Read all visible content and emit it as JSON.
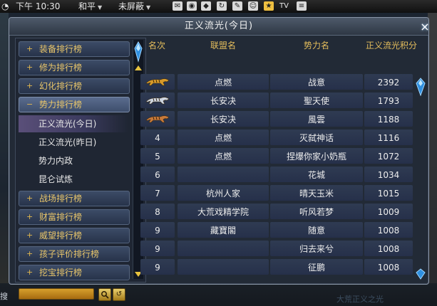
{
  "topbar": {
    "time": "下午 10:30",
    "pk_mode": "和平",
    "filter_mode": "未屏蔽",
    "tv_label": "TV"
  },
  "window": {
    "title": "正义流光(今日)",
    "close_label": "×"
  },
  "sidebar": {
    "categories": [
      {
        "label": "装备排行榜",
        "icon": "+"
      },
      {
        "label": "修为排行榜",
        "icon": "+"
      },
      {
        "label": "幻化排行榜",
        "icon": "+"
      },
      {
        "label": "势力排行榜",
        "icon": "−",
        "expanded": true
      },
      {
        "label": "战场排行榜",
        "icon": "+"
      },
      {
        "label": "财富排行榜",
        "icon": "+"
      },
      {
        "label": "威望排行榜",
        "icon": "+"
      },
      {
        "label": "孩子评价排行榜",
        "icon": "+"
      },
      {
        "label": "挖宝排行榜",
        "icon": "+"
      }
    ],
    "subitems": [
      {
        "label": "正义流光(今日)",
        "selected": true
      },
      {
        "label": "正义流光(昨日)"
      },
      {
        "label": "势力内政"
      },
      {
        "label": "昆仑试炼"
      }
    ]
  },
  "table": {
    "headers": [
      "名次",
      "联盟名",
      "势力名",
      "正义流光积分"
    ],
    "rows": [
      {
        "rank": "",
        "rank_icon": "gold-tiger-icon",
        "alliance": "点燃",
        "faction": "战意",
        "score": "2392"
      },
      {
        "rank": "",
        "rank_icon": "silver-tiger-icon",
        "alliance": "长安决",
        "faction": "聖天使",
        "score": "1793"
      },
      {
        "rank": "",
        "rank_icon": "bronze-tiger-icon",
        "alliance": "长安决",
        "faction": "風雲",
        "score": "1188"
      },
      {
        "rank": "4",
        "alliance": "点燃",
        "faction": "灭弑神话",
        "score": "1116"
      },
      {
        "rank": "5",
        "alliance": "点燃",
        "faction": "捏爆你家小奶瓶",
        "score": "1072"
      },
      {
        "rank": "6",
        "alliance": "",
        "faction": "花城",
        "score": "1034"
      },
      {
        "rank": "7",
        "alliance": "杭州人家",
        "faction": "晴天玉米",
        "score": "1015"
      },
      {
        "rank": "8",
        "alliance": "大荒戏精学院",
        "faction": "听风若梦",
        "score": "1009"
      },
      {
        "rank": "9",
        "alliance": "藏寶閣",
        "faction": "随意",
        "score": "1008"
      },
      {
        "rank": "9",
        "alliance": "",
        "faction": "归去来兮",
        "score": "1008"
      },
      {
        "rank": "9",
        "alliance": "",
        "faction": "征鹏",
        "score": "1008"
      }
    ]
  },
  "bottom": {
    "search_value": "",
    "edge_char": "搜",
    "faded_text": "大荒正义之光"
  },
  "colors": {
    "accent_gold": "#e4bd5c",
    "cell_bg": "#2f3b52",
    "selected_bg": "#5a4f79"
  }
}
